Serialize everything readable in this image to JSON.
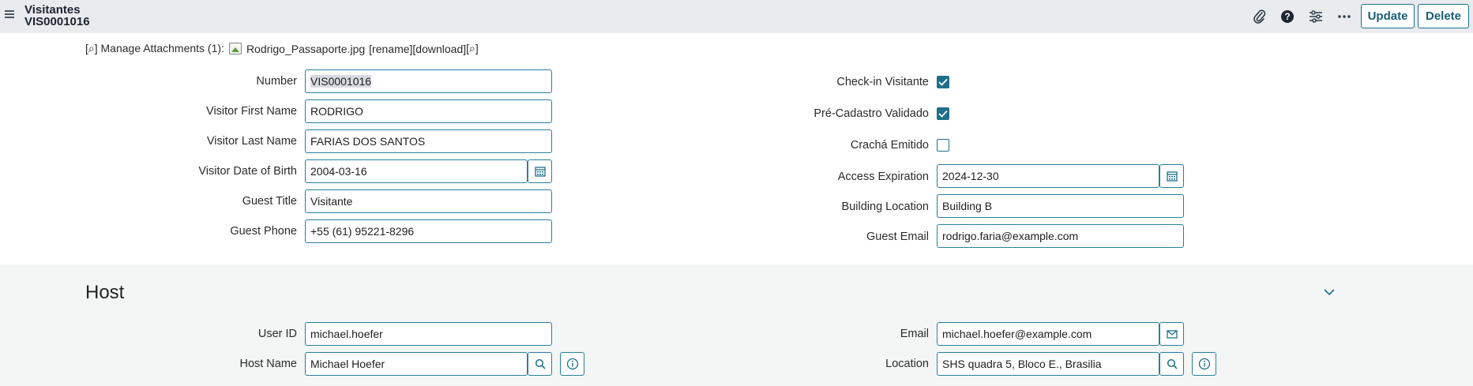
{
  "header": {
    "title": "Visitantes",
    "record": "VIS0001016",
    "update_label": "Update",
    "delete_label": "Delete"
  },
  "attachments": {
    "prefix": "[⌕] Manage Attachments (1):",
    "file_name": "Rodrigo_Passaporte.jpg",
    "rename_label": "[rename]",
    "download_label": "[download]",
    "view_label": "[⌕]"
  },
  "left_fields": {
    "number_label": "Number",
    "number_value": "VIS0001016",
    "first_name_label": "Visitor First Name",
    "first_name_value": "RODRIGO",
    "last_name_label": "Visitor Last Name",
    "last_name_value": "FARIAS DOS SANTOS",
    "dob_label": "Visitor Date of Birth",
    "dob_value": "2004-03-16",
    "guest_title_label": "Guest Title",
    "guest_title_value": "Visitante",
    "guest_phone_label": "Guest Phone",
    "guest_phone_value": "+55 (61) 95221-8296"
  },
  "right_fields": {
    "checkin_label": "Check-in Visitante",
    "checkin_checked": true,
    "precadastro_label": "Pré-Cadastro Validado",
    "precadastro_checked": true,
    "cracha_label": "Crachá Emitido",
    "cracha_checked": false,
    "access_expiration_label": "Access Expiration",
    "access_expiration_value": "2024-12-30",
    "building_location_label": "Building Location",
    "building_location_value": "Building B",
    "guest_email_label": "Guest Email",
    "guest_email_value": "rodrigo.faria@example.com"
  },
  "host": {
    "section_title": "Host",
    "user_id_label": "User ID",
    "user_id_value": "michael.hoefer",
    "host_name_label": "Host Name",
    "host_name_value": "Michael Hoefer",
    "email_label": "Email",
    "email_value": "michael.hoefer@example.com",
    "location_label": "Location",
    "location_value": "SHS quadra 5, Bloco E., Brasilia"
  },
  "icons": {
    "menu": "hamburger-menu-icon",
    "attach": "paperclip-icon",
    "help": "help-icon",
    "settings": "sliders-icon",
    "more": "more-options-icon",
    "calendar": "calendar-icon",
    "search": "magnifier-icon",
    "info": "info-icon",
    "mail": "envelope-icon",
    "collapse": "chevron-down-icon"
  },
  "colors": {
    "accent": "#1f6f8b",
    "header_bg": "#e9ebee",
    "section_bg": "#f4f5f5"
  }
}
